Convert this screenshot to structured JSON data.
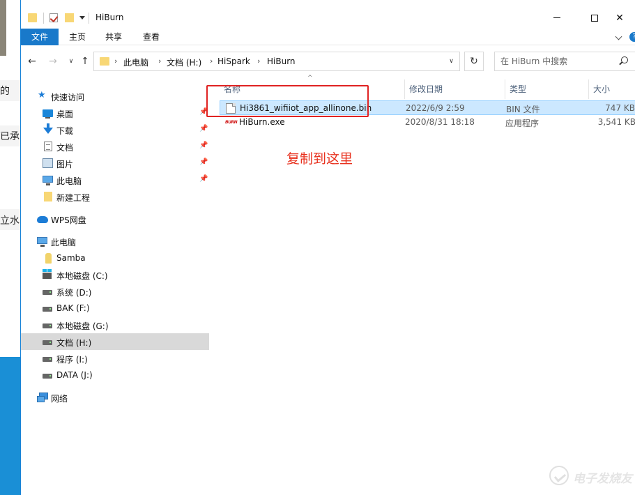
{
  "background": {
    "left_fragments": [
      "的",
      "已承",
      "立水"
    ]
  },
  "window": {
    "title": "HiBurn",
    "controls": {
      "minimize": "—",
      "maximize": "☐",
      "close": "✕"
    }
  },
  "ribbon": {
    "tabs": [
      {
        "label": "文件",
        "active": true
      },
      {
        "label": "主页",
        "active": false
      },
      {
        "label": "共享",
        "active": false
      },
      {
        "label": "查看",
        "active": false
      }
    ],
    "help_label": "?"
  },
  "navigation": {
    "back_glyph": "←",
    "forward_glyph": "→",
    "recent_glyph": "∨",
    "up_glyph": "↑",
    "refresh_glyph": "↻",
    "dropdown_glyph": "∨",
    "breadcrumb": [
      "此电脑",
      "文档 (H:)",
      "HiSpark",
      "HiBurn"
    ],
    "breadcrumb_separator": "›",
    "search_placeholder": "在 HiBurn 中搜索"
  },
  "sidebar": {
    "pin_glyph": "📌",
    "items": [
      {
        "label": "快速访问",
        "icon": "star-icon",
        "level": 0,
        "pinned": false,
        "selected": false
      },
      {
        "label": "桌面",
        "icon": "desktop-icon",
        "level": 1,
        "pinned": true,
        "selected": false
      },
      {
        "label": "下载",
        "icon": "download-icon",
        "level": 1,
        "pinned": true,
        "selected": false
      },
      {
        "label": "文档",
        "icon": "documents-icon",
        "level": 1,
        "pinned": true,
        "selected": false
      },
      {
        "label": "图片",
        "icon": "pictures-icon",
        "level": 1,
        "pinned": true,
        "selected": false
      },
      {
        "label": "此电脑",
        "icon": "computer-icon",
        "level": 1,
        "pinned": true,
        "selected": false
      },
      {
        "label": "新建工程",
        "icon": "folder-icon",
        "level": 1,
        "pinned": false,
        "selected": false
      },
      {
        "label": "WPS网盘",
        "icon": "cloud-icon",
        "level": 0,
        "pinned": false,
        "selected": false
      },
      {
        "label": "此电脑",
        "icon": "computer-icon",
        "level": 0,
        "pinned": false,
        "selected": false
      },
      {
        "label": "Samba",
        "icon": "samba-icon",
        "level": 1,
        "pinned": false,
        "selected": false
      },
      {
        "label": "本地磁盘 (C:)",
        "icon": "windows-drive-icon",
        "level": 1,
        "pinned": false,
        "selected": false
      },
      {
        "label": "系统 (D:)",
        "icon": "drive-icon",
        "level": 1,
        "pinned": false,
        "selected": false
      },
      {
        "label": "BAK (F:)",
        "icon": "drive-icon",
        "level": 1,
        "pinned": false,
        "selected": false
      },
      {
        "label": "本地磁盘 (G:)",
        "icon": "drive-icon",
        "level": 1,
        "pinned": false,
        "selected": false
      },
      {
        "label": "文档 (H:)",
        "icon": "drive-icon",
        "level": 1,
        "pinned": false,
        "selected": true
      },
      {
        "label": "程序 (I:)",
        "icon": "drive-icon",
        "level": 1,
        "pinned": false,
        "selected": false
      },
      {
        "label": "DATA (J:)",
        "icon": "drive-icon",
        "level": 1,
        "pinned": false,
        "selected": false
      },
      {
        "label": "网络",
        "icon": "network-icon",
        "level": 0,
        "pinned": false,
        "selected": false
      }
    ]
  },
  "file_list": {
    "sort_glyph": "^",
    "columns": {
      "name": "名称",
      "date": "修改日期",
      "type": "类型",
      "size": "大小"
    },
    "files": [
      {
        "name": "Hi3861_wifiiot_app_allinone.bin",
        "date": "2022/6/9 2:59",
        "type": "BIN 文件",
        "size": "747 KB",
        "icon": "bin-file-icon",
        "selected": true
      },
      {
        "name": "HiBurn.exe",
        "date": "2020/8/31 18:18",
        "type": "应用程序",
        "size": "3,541 KB",
        "icon": "exe-file-icon",
        "selected": false
      }
    ],
    "exe_icon_text": "BURN"
  },
  "annotation": {
    "text": "复制到这里",
    "color": "#e8311e"
  },
  "watermark": {
    "text": "电子发烧友"
  },
  "colors": {
    "accent": "#1979ca",
    "selection": "#cce8ff",
    "sidebar_selection": "#d9d9d9",
    "highlight_box": "#e02222"
  }
}
